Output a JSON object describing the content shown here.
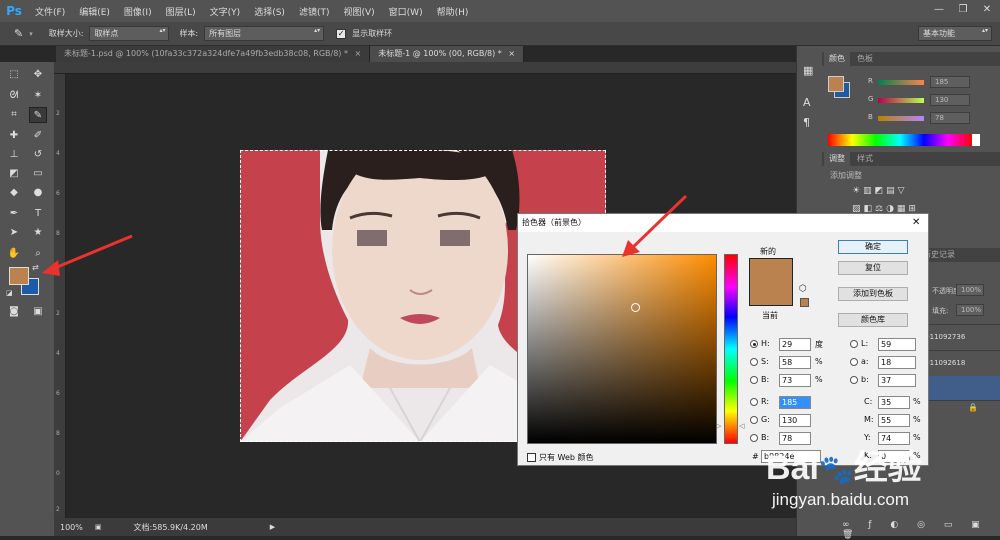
{
  "app": {
    "logo": "Ps"
  },
  "menu": [
    "文件(F)",
    "编辑(E)",
    "图像(I)",
    "图层(L)",
    "文字(Y)",
    "选择(S)",
    "滤镜(T)",
    "视图(V)",
    "窗口(W)",
    "帮助(H)"
  ],
  "window_controls": {
    "minimize": "—",
    "restore": "❐",
    "close": "✕"
  },
  "options": {
    "sample_size_label": "取样大小:",
    "sample_size_value": "取样点",
    "sample_label": "样本:",
    "sample_value": "所有图层",
    "show_ring_label": "显示取样环",
    "workspace_value": "基本功能"
  },
  "doc_tabs": [
    {
      "label": "未标题-1.psd @ 100% (10fa33c372a324dfe7a49fb3edb38c08, RGB/8) *",
      "close": "×"
    },
    {
      "label": "未标题-1 @ 100% (00, RGB/8) *",
      "close": "×"
    }
  ],
  "rulers": {
    "left_ticks": [
      "2",
      "4",
      "6",
      "8",
      "0",
      "2",
      "4",
      "6",
      "8",
      "0",
      "2"
    ]
  },
  "status": {
    "zoom": "100%",
    "doc": "文档:585.9K/4.20M"
  },
  "panel": {
    "tabs": [
      "颜色",
      "色板"
    ],
    "r_label": "R",
    "g_label": "G",
    "b_label": "B",
    "r": "185",
    "g": "130",
    "b": "78",
    "adjust_tabs": [
      "调整",
      "样式"
    ],
    "adjust_add": "添加调整",
    "history_tab": "历史记录",
    "opacity_label": "不透明度:",
    "opacity": "100%",
    "fill_label": "填充:",
    "fill": "100%",
    "layer1": "10fa33c372a324dfe7a4910911092736",
    "layer2": "10fa33c372a324dfe7a4910911092618",
    "lock_icon": "🔒"
  },
  "picker": {
    "title": "拾色器（前景色）",
    "new_label": "新的",
    "current_label": "当前",
    "ok": "确定",
    "reset": "复位",
    "add_swatch": "添加到色板",
    "color_lib": "颜色库",
    "h_label": "H:",
    "h": "29",
    "h_unit": "度",
    "s_label": "S:",
    "s": "58",
    "s_unit": "%",
    "bb_label": "B:",
    "bb": "73",
    "bb_unit": "%",
    "r_label": "R:",
    "r": "185",
    "g_label": "G:",
    "g": "130",
    "b_label": "B:",
    "b": "78",
    "l_label": "L:",
    "l": "59",
    "a_label": "a:",
    "a": "18",
    "lb_label": "b:",
    "lb": "37",
    "c_label": "C:",
    "c": "35",
    "c_unit": "%",
    "m_label": "M:",
    "m": "55",
    "m_unit": "%",
    "y_label": "Y:",
    "y": "74",
    "y_unit": "%",
    "k_label": "K:",
    "k": "0",
    "k_unit": "%",
    "web_only": "只有 Web 颜色",
    "hex_label": "#",
    "hex": "b9824e",
    "new_color": "#b9824e",
    "current_color": "#b9824e"
  },
  "watermark": {
    "brand_pre": "Bai",
    "brand_post": "经验",
    "url": "jingyan.baidu.com"
  },
  "colors": {
    "foreground": "#b9824e",
    "background": "#1d5aa8",
    "backdrop": "#c5424d",
    "annotation": "#e8332e"
  }
}
